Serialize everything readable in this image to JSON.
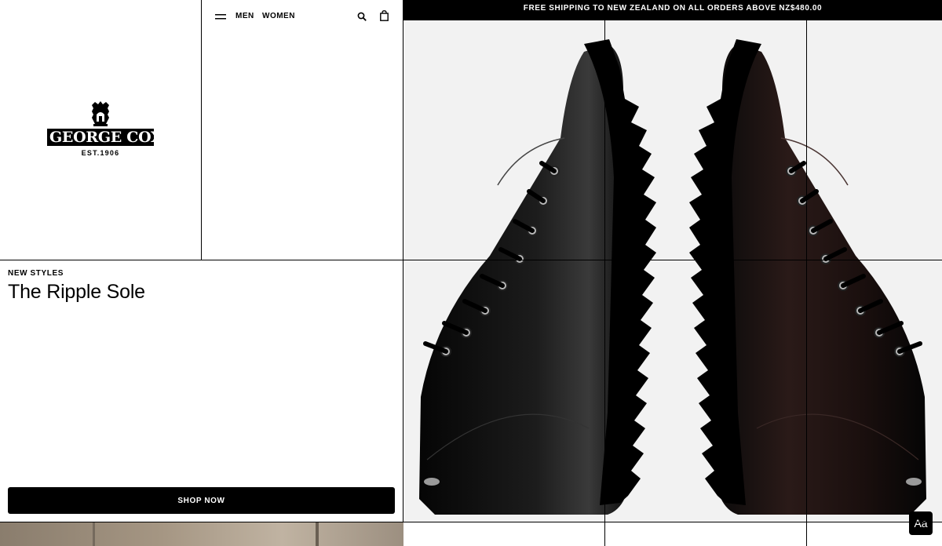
{
  "brand": {
    "name": "GEORGE COX",
    "established": "EST.1906"
  },
  "nav": {
    "men_label": "MEN",
    "women_label": "WOMEN",
    "icons": [
      "menu-icon",
      "search-icon",
      "bag-icon"
    ]
  },
  "promo": {
    "text": "FREE SHIPPING TO NEW ZEALAND ON ALL ORDERS ABOVE NZ$480.00"
  },
  "feature": {
    "eyebrow": "NEW STYLES",
    "headline": "The Ripple Sole",
    "cta_label": "SHOP NOW"
  },
  "font_button": {
    "label": "Aa"
  },
  "colors": {
    "primary": "#000000",
    "background": "#ffffff",
    "hero_background": "#f1f1f1"
  }
}
